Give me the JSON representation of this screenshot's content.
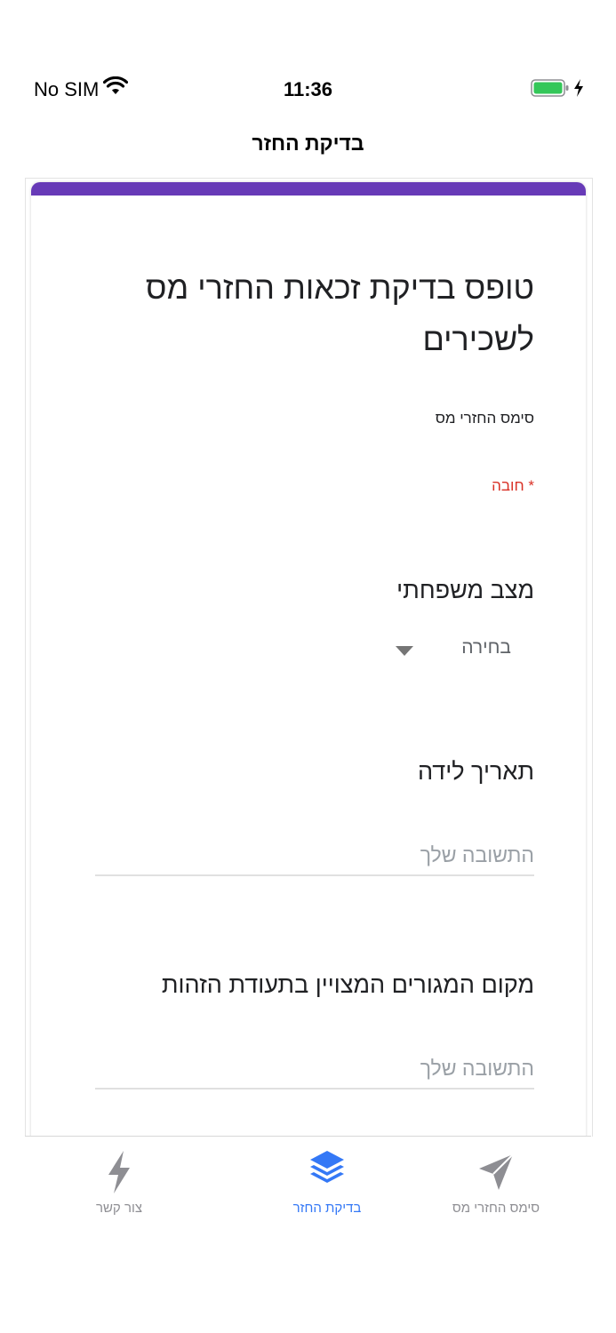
{
  "status_bar": {
    "carrier": "No SIM",
    "time": "11:36"
  },
  "nav": {
    "title": "בדיקת החזר"
  },
  "form": {
    "accent_color": "#673ab7",
    "title": "טופס בדיקת זכאות החזרי מס לשכירים",
    "description": "סימס החזרי מס",
    "required_note": "* חובה",
    "questions": [
      {
        "label": "מצב משפחתי",
        "type": "dropdown",
        "selected": "בחירה"
      },
      {
        "label": "תאריך לידה",
        "type": "text",
        "placeholder": "התשובה שלך",
        "value": ""
      },
      {
        "label": "מקום המגורים המצויין בתעודת הזהות",
        "type": "text",
        "placeholder": "התשובה שלך",
        "value": ""
      }
    ]
  },
  "tab_bar": {
    "active_color": "#3478f6",
    "inactive_color": "#8e8e93",
    "tabs": [
      {
        "label": "צור קשר",
        "icon": "lightning-icon",
        "active": false
      },
      {
        "label": "בדיקת החזר",
        "icon": "layers-icon",
        "active": true
      },
      {
        "label": "סימס החזרי מס",
        "icon": "send-icon",
        "active": false
      }
    ]
  }
}
